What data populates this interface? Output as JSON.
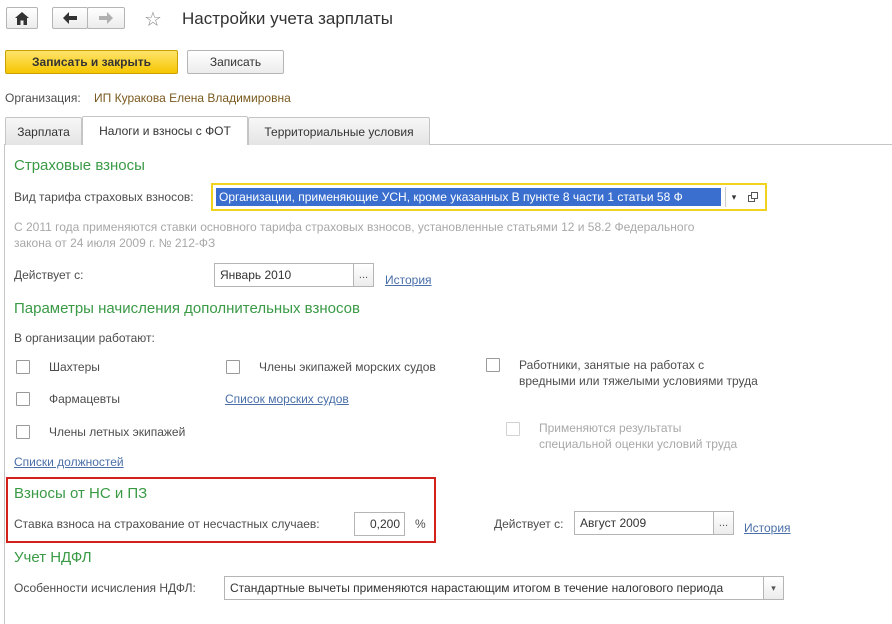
{
  "header": {
    "title": "Настройки учета зарплаты",
    "home_icon": "home-icon",
    "back_icon": "arrow-left-icon",
    "forward_icon": "arrow-right-icon",
    "favorite_icon": "star-icon"
  },
  "toolbar": {
    "save_close_label": "Записать и закрыть",
    "save_label": "Записать"
  },
  "organization": {
    "label": "Организация:",
    "value": "ИП Куракова Елена Владимировна"
  },
  "tabs": [
    {
      "label": "Зарплата",
      "active": false
    },
    {
      "label": "Налоги и взносы с ФОТ",
      "active": true
    },
    {
      "label": "Территориальные условия",
      "active": false
    }
  ],
  "insurance": {
    "title": "Страховые взносы",
    "tariff_label": "Вид тарифа страховых взносов:",
    "tariff_value": "Организации, применяющие УСН, кроме указанных В пункте 8 части 1 статьи 58 Ф",
    "note_line1": "С 2011 года применяются ставки основного тарифа страховых взносов, установленные статьями 12 и 58.2 Федерального",
    "note_line2": "закона от 24 июля 2009 г. № 212-ФЗ",
    "effective_label": "Действует с:",
    "effective_value": "Январь 2010",
    "history_link": "История"
  },
  "additional": {
    "title": "Параметры начисления дополнительных взносов",
    "works_label": "В организации работают:",
    "checkboxes": [
      {
        "label": "Шахтеры",
        "checked": false
      },
      {
        "label": "Фармацевты",
        "checked": false
      },
      {
        "label": "Члены летных экипажей",
        "checked": false
      },
      {
        "label": "Члены экипажей морских судов",
        "checked": false
      },
      {
        "label_line1": "Работники, занятые на работах с",
        "label_line2": "вредными или тяжелыми условиями труда",
        "checked": false
      },
      {
        "label_line1": "Применяются результаты",
        "label_line2": "специальной оценки условий труда",
        "checked": false,
        "disabled": true
      }
    ],
    "ships_link": "Список морских судов",
    "positions_link": "Списки должностей"
  },
  "accident": {
    "title": "Взносы от НС и ПЗ",
    "rate_label": "Ставка взноса на страхование от несчастных случаев:",
    "rate_value": "0,200",
    "rate_unit": "%",
    "effective_label": "Действует с:",
    "effective_value": "Август 2009",
    "history_link": "История",
    "highlight_color": "#d2201a"
  },
  "ndfl": {
    "title": "Учет НДФЛ",
    "label": "Особенности исчисления НДФЛ:",
    "value": "Стандартные вычеты применяются нарастающим итогом в течение налогового периода"
  },
  "colors": {
    "section_title": "#3a9a46",
    "primary_button": "#f5c600",
    "link": "#4a6fa8",
    "selection": "#3a6fcf",
    "focus_outline": "#f1d21c"
  }
}
